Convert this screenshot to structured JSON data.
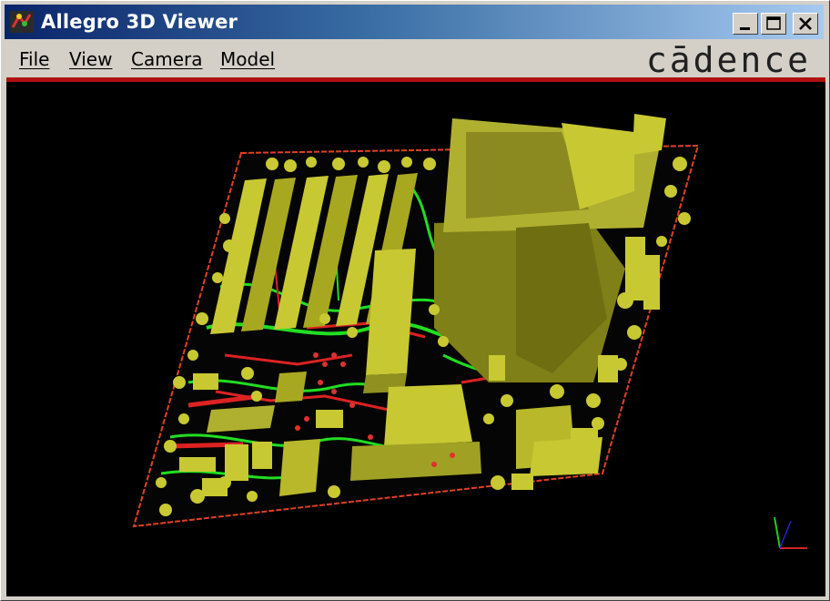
{
  "window": {
    "title": "Allegro 3D Viewer",
    "controls": [
      "minimize",
      "maximize",
      "close"
    ]
  },
  "menu": {
    "items": [
      {
        "label": "File"
      },
      {
        "label": "View"
      },
      {
        "label": "Camera"
      },
      {
        "label": "Model"
      }
    ]
  },
  "brand": {
    "text": "cādence"
  },
  "colors": {
    "titlebar_start": "#0a246a",
    "titlebar_end": "#a6caf0",
    "accent_line": "#b01010",
    "viewport_bg": "#000000",
    "component": "#c8c832",
    "trace_green": "#22dd22",
    "trace_red": "#dd2222"
  },
  "viewport": {
    "content": "3d-pcb-model"
  }
}
